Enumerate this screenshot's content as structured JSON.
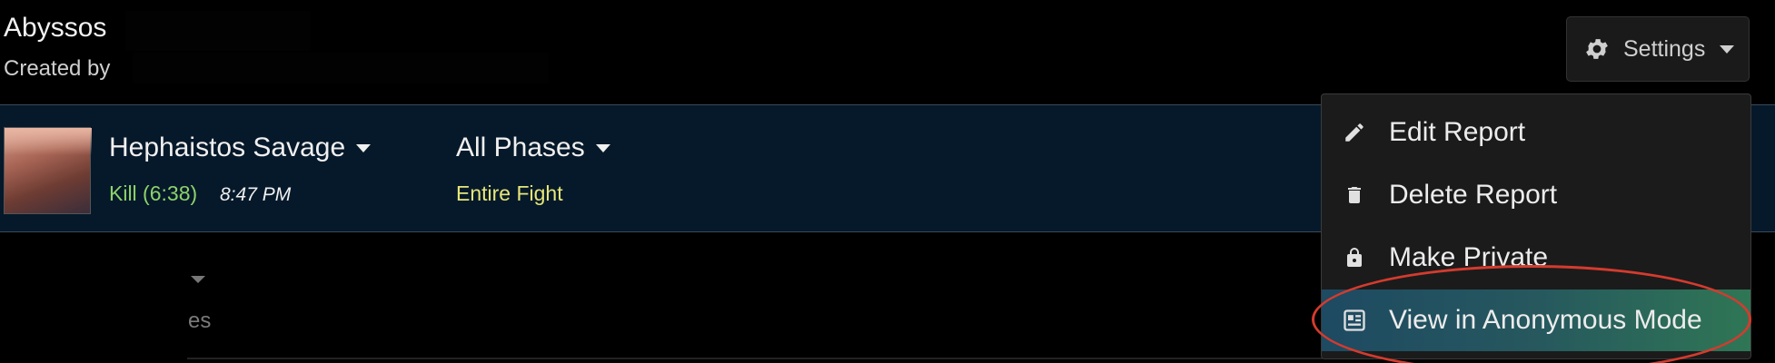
{
  "header": {
    "title": "Abyssos",
    "created_by_label": "Created by"
  },
  "settings": {
    "label": "Settings",
    "icon": "gear-icon"
  },
  "fight": {
    "boss_name": "Hephaistos Savage",
    "result": "Kill (6:38)",
    "time": "8:47 PM",
    "phase_selector": "All Phases",
    "phase_range": "Entire Fight",
    "colors": {
      "kill": "#8ed26a",
      "phase_range": "#e6e67a",
      "bar_bg": "#06192a"
    }
  },
  "background_partial": {
    "text": "es"
  },
  "menu": {
    "items": [
      {
        "label": "Edit Report",
        "icon": "pencil-icon"
      },
      {
        "label": "Delete Report",
        "icon": "trash-icon"
      },
      {
        "label": "Make Private",
        "icon": "lock-icon"
      },
      {
        "label": "View in Anonymous Mode",
        "icon": "anonymous-mode-icon",
        "active": true
      }
    ]
  },
  "annotation": {
    "color": "#d43b2e",
    "shape": "ellipse"
  }
}
